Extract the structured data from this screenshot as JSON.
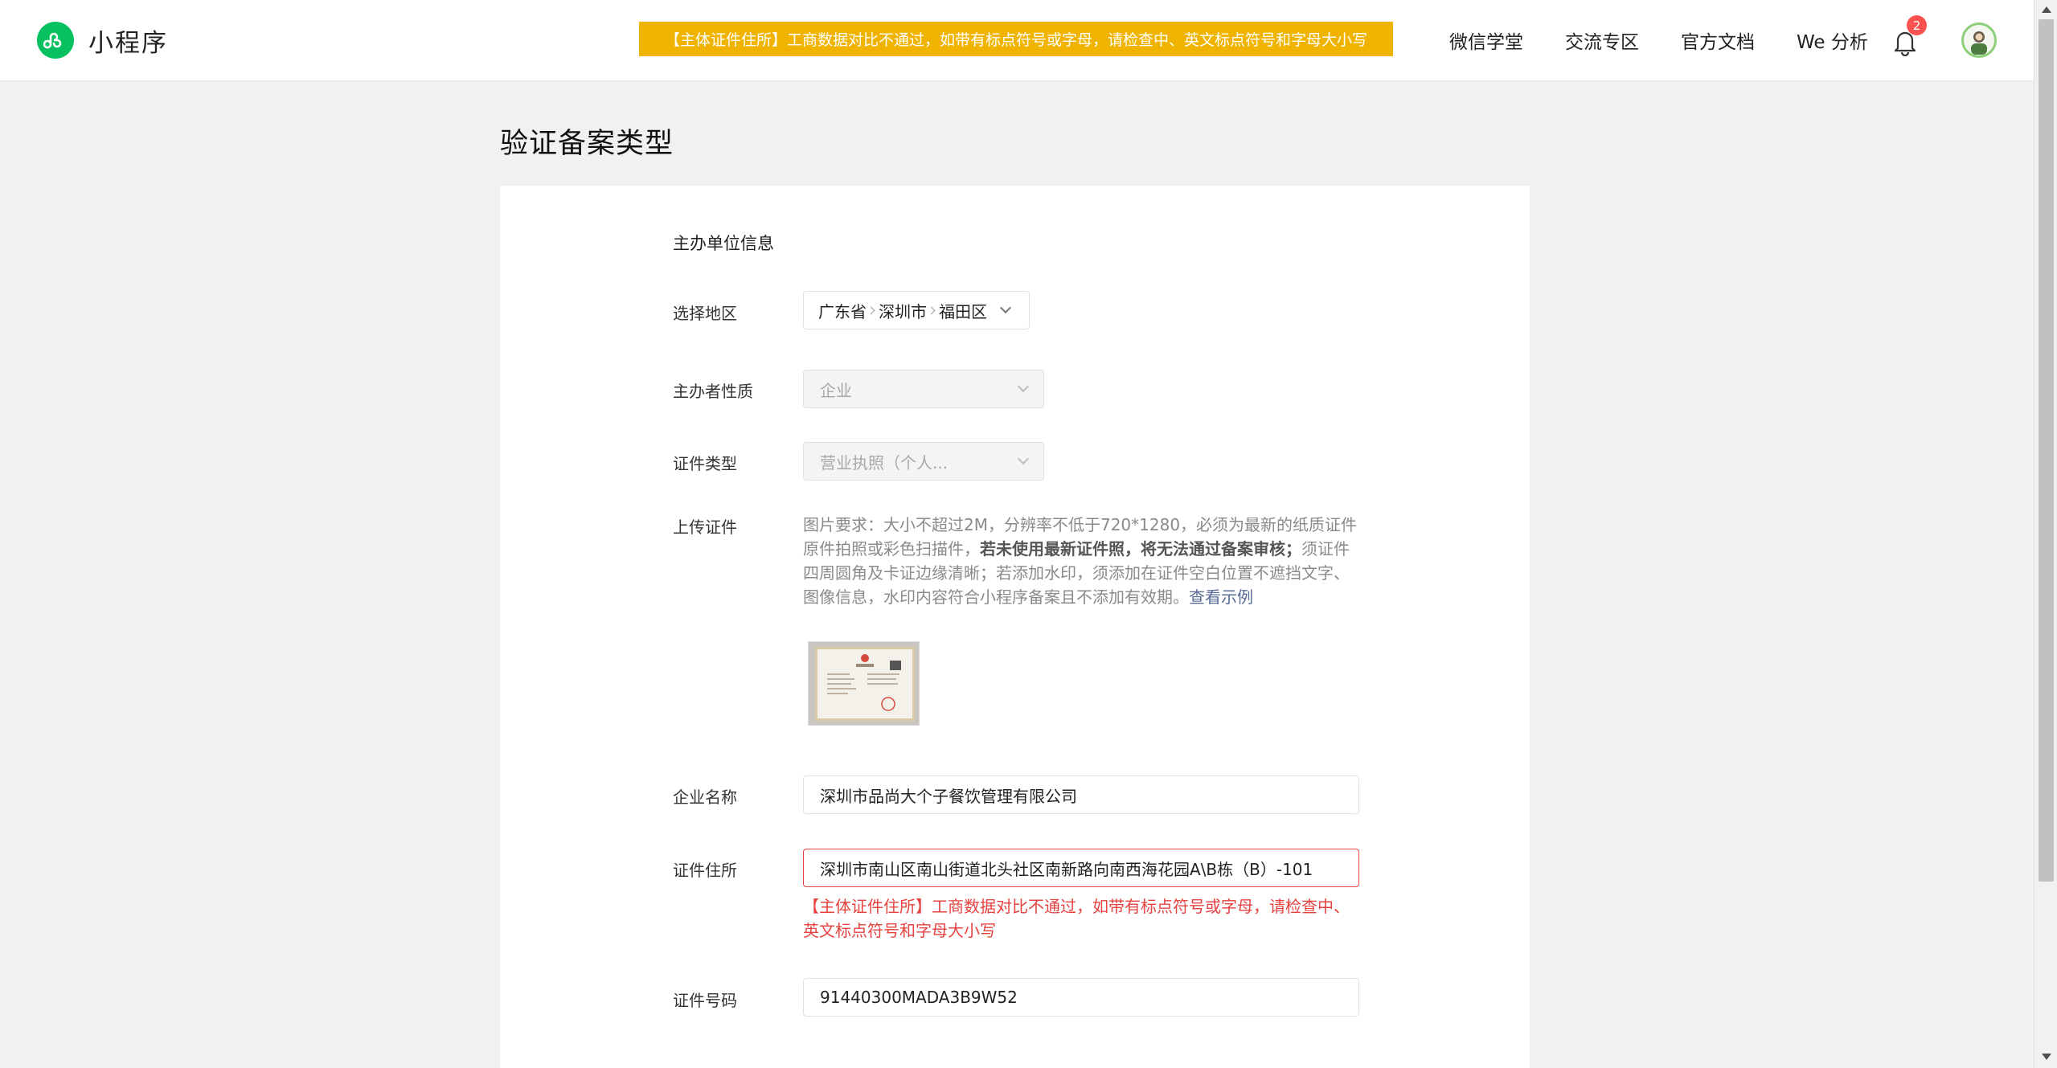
{
  "header": {
    "brand_name": "小程序",
    "notice": "【主体证件住所】工商数据对比不通过，如带有标点符号或字母，请检查中、英文标点符号和字母大小写",
    "nav": [
      "微信学堂",
      "交流专区",
      "官方文档",
      "We 分析"
    ],
    "notification_count": "2"
  },
  "page": {
    "title": "验证备案类型"
  },
  "form": {
    "section_title": "主办单位信息",
    "region": {
      "label": "选择地区",
      "province": "广东省",
      "city": "深圳市",
      "district": "福田区"
    },
    "nature": {
      "label": "主办者性质",
      "value": "企业"
    },
    "cert_type": {
      "label": "证件类型",
      "value": "营业执照（个人..."
    },
    "upload": {
      "label": "上传证件",
      "desc_part1": "图片要求：大小不超过2M，分辨率不低于720*1280，必须为最新的纸质证件原件拍照或彩色扫描件，",
      "desc_bold": "若未使用最新证件照，将无法通过备案审核；",
      "desc_part2": "须证件四周圆角及卡证边缘清晰；若添加水印，须添加在证件空白位置不遮挡文字、图像信息，水印内容符合小程序备案且不添加有效期。",
      "example_link": "查看示例"
    },
    "company_name": {
      "label": "企业名称",
      "value": "深圳市品尚大个子餐饮管理有限公司"
    },
    "cert_address": {
      "label": "证件住所",
      "value": "深圳市南山区南山街道北头社区南新路向南西海花园A\\B栋（B）-101",
      "error": "【主体证件住所】工商数据对比不通过，如带有标点符号或字母，请检查中、英文标点符号和字母大小写"
    },
    "cert_number": {
      "label": "证件号码",
      "value": "91440300MADA3B9W52"
    }
  },
  "colors": {
    "brand_green": "#07c160",
    "banner_bg": "#f0b400",
    "error_red": "#e64340",
    "link_blue": "#576b95"
  }
}
